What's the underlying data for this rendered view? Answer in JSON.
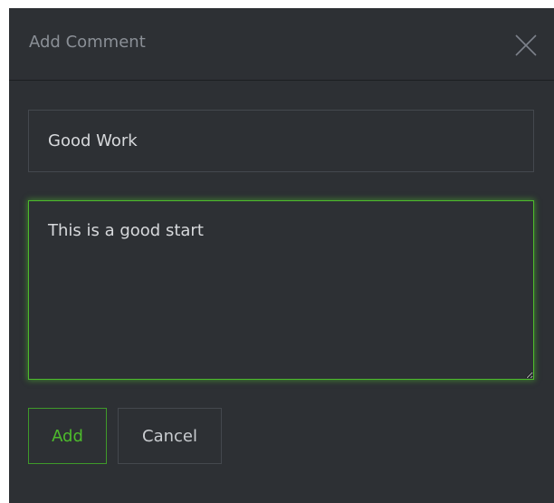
{
  "dialog": {
    "title": "Add Comment",
    "close_icon": "close-icon"
  },
  "form": {
    "title_value": "Good Work",
    "comment_value": "This is a good start"
  },
  "buttons": {
    "add_label": "Add",
    "cancel_label": "Cancel"
  },
  "colors": {
    "background": "#2d3034",
    "accent": "#4dbb2c",
    "border": "#44484e",
    "text": "#d7d9dc",
    "muted_text": "#8a8f96"
  }
}
